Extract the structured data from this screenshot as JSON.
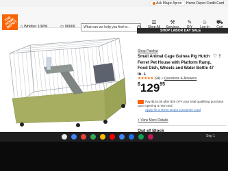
{
  "top_bar": {
    "ask_apron": "Ask Magic Apron",
    "store_link": "Home Depot Credit Card"
  },
  "header": {
    "logo_text": "THE HOME DEPOT",
    "store": "Whittier 10PM",
    "zip": "90606",
    "search_placeholder": "What can we help you find to...",
    "nav": [
      {
        "label": "Shop All",
        "icon": "menu-icon"
      },
      {
        "label": "Services",
        "icon": "wrench-icon"
      },
      {
        "label": "DIY",
        "icon": "tools-icon"
      },
      {
        "label": "Log In",
        "icon": "user-icon"
      },
      {
        "label": "Cart",
        "icon": "cart-icon"
      }
    ]
  },
  "promo": {
    "text": "SHOP LABOR DAY SALE"
  },
  "product": {
    "brand": "Shop Pawhut",
    "title": "Small Animal Cage Guinea Pig Hutch Ferret Pet House with Platform Ramp, Food Dish, Wheels and Water Bottle 47 in. L",
    "stars": "★★★★★",
    "rating": 4.5,
    "review_count": "(94)",
    "qa_label": "Questions & Answers",
    "price_dollar": "$",
    "price_whole": "129",
    "price_cents": "95",
    "card_offer": "Pay $104.95 after $25 OFF your total qualifying purchase upon opening a new card.",
    "card_link": "Apply for a Home Depot Consumer Card",
    "view_more": "View More Details",
    "stock_status": "Out of Stock"
  },
  "colors": {
    "brand_orange": "#f96302",
    "link_blue": "#3b73b9",
    "cage_base": "#9aa356"
  },
  "taskbar": {
    "status": "Sep 1"
  }
}
